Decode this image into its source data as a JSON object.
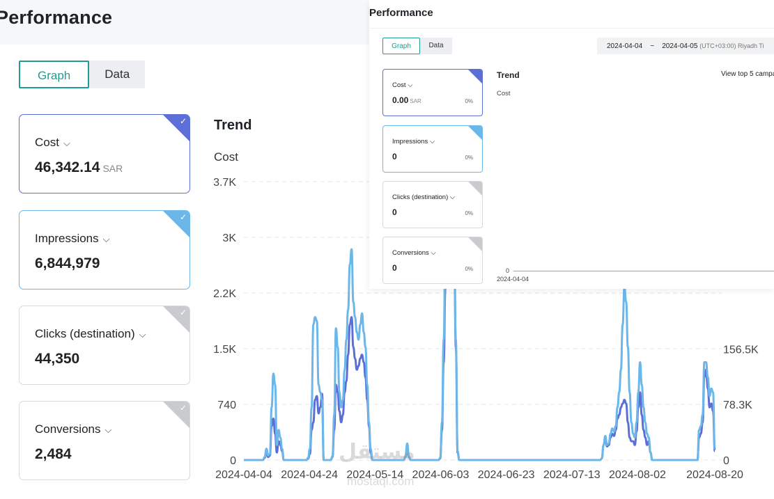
{
  "page": {
    "title": "Performance"
  },
  "tabs": [
    {
      "label": "Graph"
    },
    {
      "label": "Data"
    }
  ],
  "metrics": [
    {
      "label": "Cost",
      "value": "46,342.14",
      "unit": "SAR",
      "selected": true,
      "color": "#5b6fd6"
    },
    {
      "label": "Impressions",
      "value": "6,844,979",
      "unit": "",
      "selected": true,
      "color": "#6cb7ea"
    },
    {
      "label": "Clicks (destination)",
      "value": "44,350",
      "unit": "",
      "selected": false,
      "color": "#c9cbce"
    },
    {
      "label": "Conversions",
      "value": "2,484",
      "unit": "",
      "selected": false,
      "color": "#c9cbce"
    }
  ],
  "trend": {
    "title": "Trend",
    "metric_label": "Cost"
  },
  "chart_data": {
    "type": "line",
    "x": [
      "2024-04-04",
      "2024-04-24",
      "2024-05-14",
      "2024-06-03",
      "2024-06-23",
      "2024-07-13",
      "2024-08-02",
      "2024-08-20"
    ],
    "left_ticks": [
      "0",
      "740",
      "1.5K",
      "2.2K",
      "3K",
      "3.7K"
    ],
    "right_ticks": [
      "0",
      "78.3K",
      "156.5K"
    ],
    "left_ylim": [
      0,
      3700
    ],
    "right_ylim": [
      0,
      392000
    ],
    "series": [
      {
        "color": "#5b6fd6",
        "axis": "left",
        "values": [
          0,
          0,
          0,
          0,
          0,
          0,
          0,
          0,
          0,
          0,
          0,
          0,
          30,
          100,
          40,
          60,
          450,
          550,
          350,
          100,
          250,
          200,
          120,
          0,
          0,
          0,
          0,
          0,
          0,
          0,
          0,
          0,
          0,
          0,
          0,
          0,
          0,
          20,
          80,
          400,
          500,
          800,
          850,
          620,
          700,
          880,
          0,
          0,
          0,
          0,
          0,
          40,
          400,
          1000,
          900,
          650,
          500,
          600,
          900,
          1050,
          1400,
          1800,
          1900,
          1500,
          1350,
          1200,
          1250,
          1350,
          1400,
          1300,
          1100,
          800,
          450,
          100,
          0,
          0,
          0,
          0,
          0,
          0,
          0,
          0,
          0,
          0,
          0,
          0,
          0,
          0,
          0,
          0,
          0,
          0,
          0,
          40,
          180,
          40,
          0,
          0,
          0,
          0,
          0,
          0,
          0,
          0,
          0,
          0,
          0,
          0,
          0,
          0,
          0,
          0,
          0,
          20,
          400,
          1300,
          2300,
          3000,
          3400,
          3600,
          3600,
          2900,
          1500,
          100,
          0,
          0,
          0,
          0,
          0,
          0,
          0,
          0,
          0,
          0,
          0,
          0,
          0,
          0,
          0,
          0,
          0,
          0,
          0,
          0,
          0,
          0,
          0,
          0,
          0,
          0,
          0,
          0,
          0,
          0,
          0,
          0,
          0,
          0,
          0,
          0,
          0,
          0,
          0,
          0,
          0,
          0,
          0,
          0,
          0,
          0,
          0,
          0,
          0,
          0,
          0,
          0,
          0,
          0,
          0,
          0,
          0,
          0,
          0,
          0,
          0,
          0,
          0,
          0,
          0,
          0,
          0,
          0,
          0,
          0,
          0,
          0,
          0,
          0,
          0,
          0,
          0,
          0,
          0,
          0,
          0,
          0,
          20,
          200,
          300,
          180,
          200,
          300,
          350,
          320,
          400,
          550,
          600,
          700,
          750,
          800,
          750,
          500,
          300,
          250,
          250,
          200,
          380,
          700,
          900,
          600,
          400,
          300,
          200,
          250,
          100,
          0,
          0,
          0,
          0,
          0,
          0,
          0,
          0,
          0,
          0,
          0,
          0,
          0,
          0,
          0,
          0,
          0,
          0,
          0,
          0,
          0,
          0,
          0,
          0,
          0,
          0,
          0,
          300,
          350,
          500,
          1100,
          1200,
          950,
          700,
          750,
          650,
          120
        ]
      },
      {
        "color": "#6cb7ea",
        "axis": "left",
        "values": [
          0,
          0,
          0,
          0,
          0,
          0,
          0,
          0,
          0,
          0,
          0,
          0,
          40,
          150,
          60,
          80,
          700,
          1150,
          1000,
          200,
          400,
          300,
          150,
          0,
          0,
          0,
          0,
          0,
          0,
          0,
          0,
          0,
          0,
          0,
          0,
          0,
          0,
          30,
          150,
          700,
          1800,
          1900,
          1850,
          1000,
          900,
          800,
          0,
          0,
          0,
          0,
          0,
          50,
          600,
          1750,
          1500,
          900,
          700,
          800,
          1200,
          1600,
          2000,
          2600,
          2800,
          2100,
          1900,
          1700,
          1600,
          1800,
          1950,
          1700,
          1500,
          1000,
          500,
          150,
          0,
          0,
          0,
          0,
          0,
          0,
          0,
          0,
          0,
          0,
          0,
          0,
          0,
          0,
          0,
          0,
          0,
          0,
          0,
          50,
          220,
          50,
          0,
          0,
          0,
          0,
          0,
          0,
          0,
          0,
          0,
          0,
          0,
          0,
          0,
          0,
          0,
          0,
          0,
          30,
          500,
          1600,
          2800,
          3300,
          3600,
          3600,
          3500,
          3000,
          1600,
          120,
          0,
          0,
          0,
          0,
          0,
          0,
          0,
          0,
          0,
          0,
          0,
          0,
          0,
          0,
          0,
          0,
          0,
          0,
          0,
          0,
          0,
          0,
          0,
          0,
          0,
          0,
          0,
          0,
          0,
          0,
          0,
          0,
          0,
          0,
          0,
          0,
          0,
          0,
          0,
          0,
          0,
          0,
          0,
          0,
          0,
          0,
          0,
          0,
          0,
          0,
          0,
          0,
          0,
          0,
          0,
          0,
          0,
          0,
          0,
          0,
          0,
          0,
          0,
          0,
          0,
          0,
          0,
          0,
          0,
          0,
          0,
          0,
          0,
          0,
          0,
          0,
          0,
          0,
          0,
          0,
          0,
          0,
          20,
          200,
          320,
          200,
          220,
          350,
          420,
          380,
          450,
          700,
          900,
          1200,
          1800,
          2300,
          2100,
          1500,
          900,
          500,
          350,
          300,
          500,
          900,
          1300,
          1000,
          700,
          500,
          350,
          300,
          100,
          0,
          0,
          0,
          0,
          0,
          0,
          0,
          0,
          0,
          0,
          0,
          0,
          0,
          0,
          0,
          0,
          0,
          0,
          0,
          0,
          0,
          0,
          0,
          0,
          0,
          0,
          0,
          400,
          450,
          600,
          1300,
          1300,
          1100,
          850,
          950,
          900,
          150
        ]
      }
    ]
  },
  "overlay": {
    "title": "Performance",
    "tabs": [
      {
        "label": "Graph"
      },
      {
        "label": "Data"
      }
    ],
    "date_start": "2024-04-04",
    "date_sep": "~",
    "date_end": "2024-04-05",
    "timezone": "(UTC+03:00) Riyadh Ti",
    "metrics": [
      {
        "label": "Cost",
        "value": "0.00",
        "unit": "SAR",
        "pct": "0%",
        "color": "#5b6fd6"
      },
      {
        "label": "Impressions",
        "value": "0",
        "unit": "",
        "pct": "0%",
        "color": "#6cb7ea"
      },
      {
        "label": "Clicks (destination)",
        "value": "0",
        "unit": "",
        "pct": "0%",
        "color": "#c9cbce"
      },
      {
        "label": "Conversions",
        "value": "0",
        "unit": "",
        "pct": "0%",
        "color": "#c9cbce"
      }
    ],
    "trend_title": "Trend",
    "metric_label": "Cost",
    "top5_link": "View top 5 campa",
    "y_zero": "0",
    "x_date": "2024-04-04"
  },
  "watermark": {
    "text": "مستقل",
    "url": "mostaql.com"
  }
}
